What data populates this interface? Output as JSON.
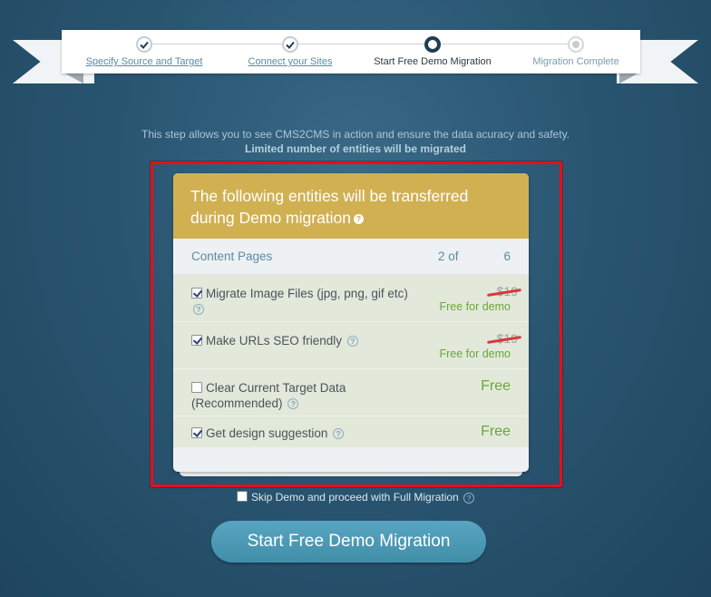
{
  "stepper": {
    "steps": [
      {
        "label": "Specify Source and Target",
        "state": "done"
      },
      {
        "label": "Connect your Sites",
        "state": "done"
      },
      {
        "label": "Start Free Demo Migration",
        "state": "current"
      },
      {
        "label": "Migration Complete",
        "state": "pending"
      }
    ]
  },
  "intro": {
    "line1": "This step allows you to see CMS2CMS in action and ensure the data acuracy and safety.",
    "line2": "Limited number of entities will be migrated"
  },
  "card": {
    "title": "The following entities will be transferred during Demo migration",
    "content_row": {
      "name": "Content Pages",
      "count": "2 of",
      "total": "6"
    },
    "options": [
      {
        "label": "Migrate Image Files (jpg, png, gif etc)",
        "checked": true,
        "old_price": "$19",
        "price": "Free for demo"
      },
      {
        "label": "Make URLs SEO friendly",
        "checked": true,
        "old_price": "$19",
        "price": "Free for demo"
      },
      {
        "label": "Clear Current Target Data (Recommended)",
        "checked": false,
        "price": "Free"
      },
      {
        "label": "Get design suggestion",
        "checked": true,
        "price": "Free"
      }
    ]
  },
  "skip": {
    "label": "Skip Demo and proceed with Full Migration",
    "checked": false
  },
  "start_button": {
    "label": "Start Free Demo Migration"
  },
  "help_glyph": "?",
  "colors": {
    "background": "#2a5672",
    "header_gold": "#d1b052",
    "free_green": "#6aa83b",
    "highlight_red": "#e4101a",
    "button_blue": "#4c9ab5"
  }
}
